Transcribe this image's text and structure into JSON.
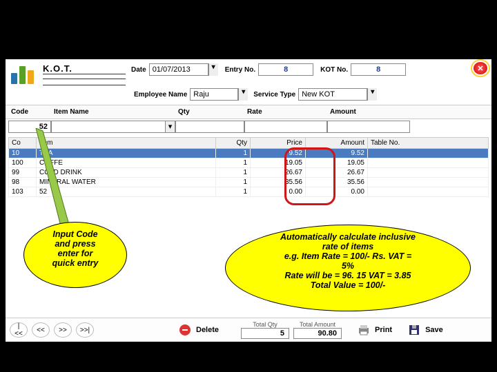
{
  "header": {
    "title": "K.O.T.",
    "date_label": "Date",
    "date_value": "01/07/2013",
    "entry_no_label": "Entry No.",
    "entry_no_value": "8",
    "kot_no_label": "KOT No.",
    "kot_no_value": "8",
    "employee_label": "Employee Name",
    "employee_value": "Raju",
    "service_type_label": "Service Type",
    "service_type_value": "New KOT"
  },
  "entry_headers": {
    "code": "Code",
    "item_name": "Item Name",
    "qty": "Qty",
    "rate": "Rate",
    "amount": "Amount"
  },
  "entry_values": {
    "code": "52"
  },
  "table": {
    "headers": {
      "code": "Co",
      "item": "Item",
      "qty": "Qty",
      "price": "Price",
      "amount": "Amount",
      "table_no": "Table No."
    },
    "rows": [
      {
        "code": "10",
        "item": "TEA",
        "qty": "1",
        "price": "9.52",
        "amount": "9.52"
      },
      {
        "code": "100",
        "item": "COFFE",
        "qty": "1",
        "price": "19.05",
        "amount": "19.05"
      },
      {
        "code": "99",
        "item": "COLD DRINK",
        "qty": "1",
        "price": "26.67",
        "amount": "26.67"
      },
      {
        "code": "98",
        "item": "MINERAL WATER",
        "qty": "1",
        "price": "35.56",
        "amount": "35.56"
      },
      {
        "code": "103",
        "item": "52",
        "qty": "1",
        "price": "0.00",
        "amount": "0.00"
      }
    ]
  },
  "callouts": {
    "c1_l1": "Input Code",
    "c1_l2": "and press",
    "c1_l3": "enter for",
    "c1_l4": "quick entry",
    "c2_l1": "Automatically calculate inclusive",
    "c2_l2": "rate of items",
    "c2_l3": "e.g. Item Rate = 100/- Rs. VAT =",
    "c2_l4": "5%",
    "c2_l5": "Rate will be = 96. 15 VAT = 3.85",
    "c2_l6": "Total Value = 100/-"
  },
  "footer": {
    "nav_first": "|<<",
    "nav_prev": "<<",
    "nav_next": ">>",
    "nav_last": ">>|",
    "delete_label": "Delete",
    "total_qty_label": "Total Qty",
    "total_qty_value": "5",
    "total_amount_label": "Total Amount",
    "total_amount_value": "90.80",
    "print_label": "Print",
    "save_label": "Save"
  },
  "colors": {
    "logo_bar1": "#2b72a8",
    "logo_bar2": "#5aa028",
    "logo_bar3": "#f0a818"
  }
}
